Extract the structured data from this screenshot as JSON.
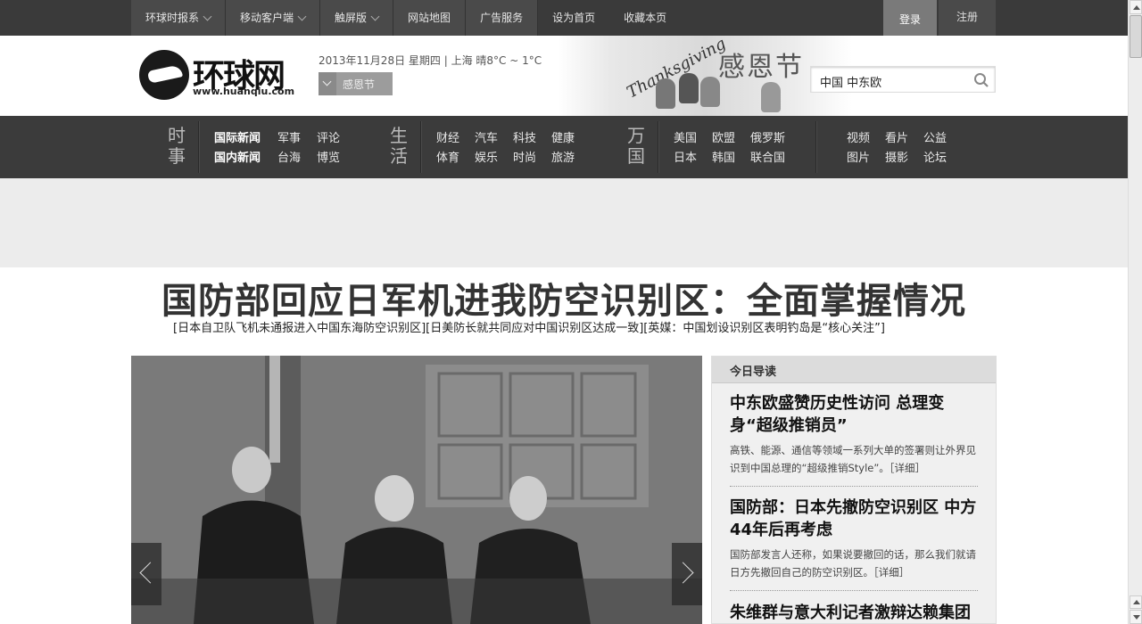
{
  "topbar": {
    "menu": [
      {
        "label": "环球时报系",
        "dropdown": true
      },
      {
        "label": "移动客户端",
        "dropdown": true
      },
      {
        "label": "触屏版",
        "dropdown": true
      },
      {
        "label": "网站地图",
        "dropdown": false
      },
      {
        "label": "广告服务",
        "dropdown": false
      }
    ],
    "set_home": "设为首页",
    "bookmark": "收藏本页",
    "login": "登录",
    "register": "注册"
  },
  "header": {
    "logo_cn": "环球网",
    "logo_en": "www.huanqiu.com",
    "dateline": "2013年11月28日 星期四 | 上海 晴8°C ~ 1°C",
    "festival_button": "感恩节",
    "banner_en": "Thanksgiving",
    "banner_cn": "感恩节",
    "search_value": "中国  中东欧"
  },
  "nav": {
    "groups": [
      {
        "category": "时事",
        "links": [
          "国际新闻",
          "军事",
          "评论",
          "国内新闻",
          "台海",
          "博览"
        ]
      },
      {
        "category": "生活",
        "links": [
          "财经",
          "汽车",
          "科技",
          "健康",
          "体育",
          "娱乐",
          "时尚",
          "旅游"
        ]
      },
      {
        "category": "万国",
        "links": [
          "美国",
          "欧盟",
          "俄罗斯",
          "日本",
          "韩国",
          "联合国"
        ]
      },
      {
        "category": "",
        "links": [
          "视频",
          "看片",
          "公益",
          "图片",
          "摄影",
          "论坛"
        ]
      }
    ]
  },
  "main": {
    "headline": "国防部回应日军机进我防空识别区：全面掌握情况",
    "subheads": "[日本自卫队飞机未通报进入中国东海防空识别区][日美防长就共同应对中国识别区达成一致][英媒：中国划设识别区表明钓岛是“核心关注”]"
  },
  "side": {
    "header": "今日导读",
    "stories": [
      {
        "title": "中东欧盛赞历史性访问 总理变身“超级推销员”",
        "desc": "高铁、能源、通信等领域一系列大单的签署则让外界见识到中国总理的“超级推销Style”。［详细］"
      },
      {
        "title": "国防部：日本先撤防空识别区 中方44年后再考虑",
        "desc": "国防部发言人还称，如果说要撤回的话，那么我们就请日方先撤回自己的防空识别区。［详细］"
      },
      {
        "title": "朱维群与意大利记者激辩达赖集团",
        "desc": ""
      }
    ]
  },
  "colors": {
    "topbar": "#3a3a3a",
    "nav": "#3b3b3b",
    "ad_area": "#ececec"
  }
}
